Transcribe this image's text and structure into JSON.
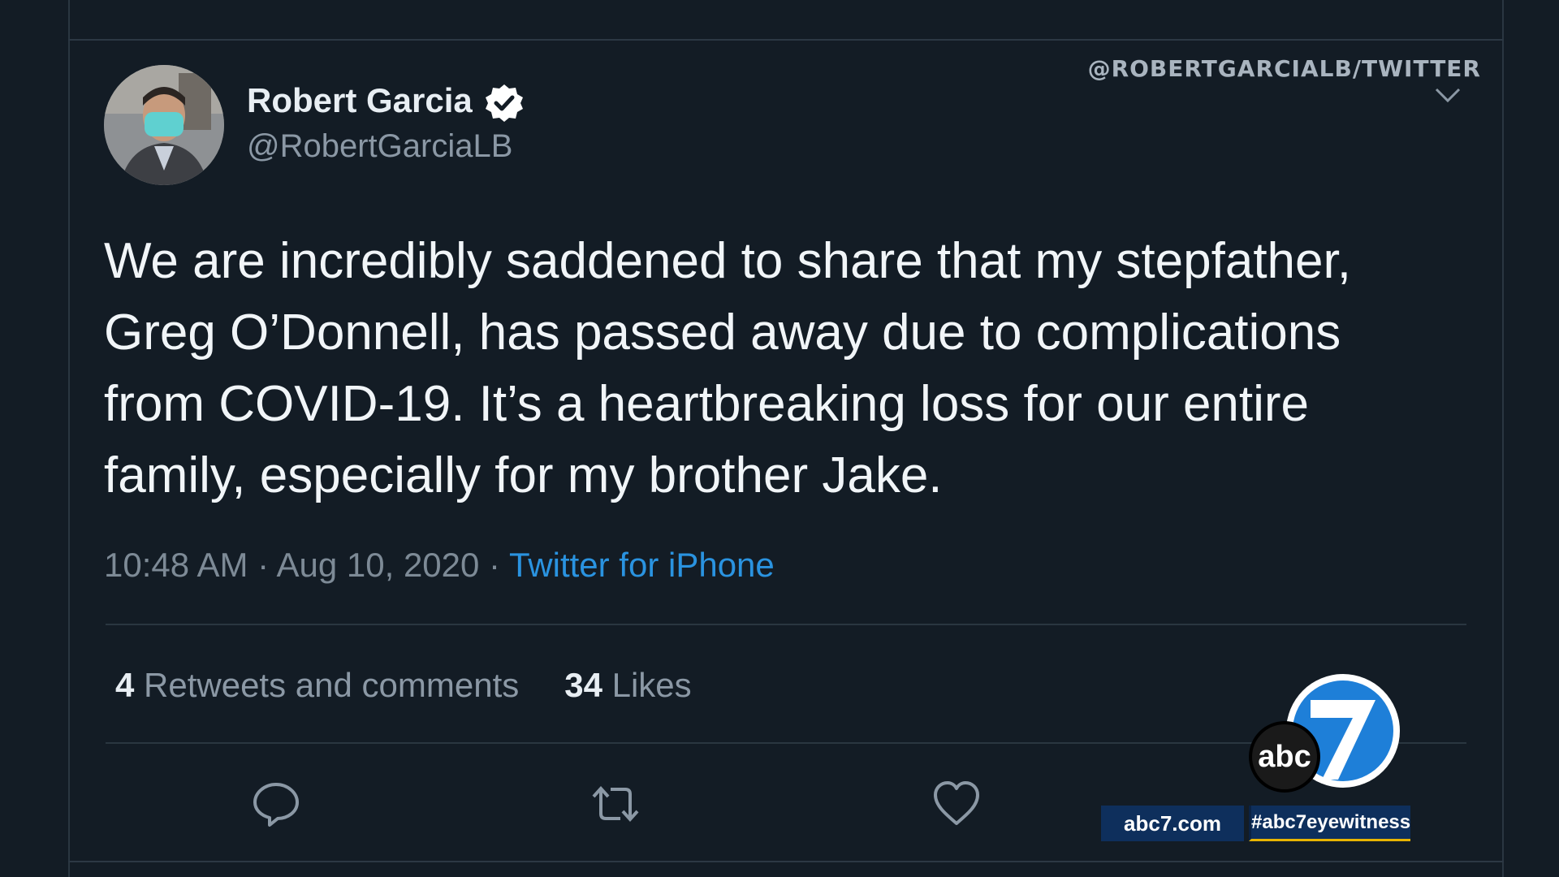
{
  "credit": "@ROBERTGARCIALB/TWITTER",
  "author": {
    "display_name": "Robert Garcia",
    "handle": "@RobertGarciaLB",
    "verified": true
  },
  "tweet": {
    "line1": "We are incredibly saddened to share that my stepfather,",
    "line2": "Greg O’Donnell, has passed away due to complications",
    "line3": "from COVID-19. It’s a heartbreaking loss for our entire",
    "line4": "family, especially for my brother Jake."
  },
  "meta": {
    "time": "10:48 AM",
    "sep1": " · ",
    "date": "Aug 10, 2020",
    "sep2": " · ",
    "source": "Twitter for iPhone"
  },
  "stats": {
    "retweets_count": "4",
    "retweets_label": " Retweets and comments",
    "likes_count": "34",
    "likes_label": " Likes"
  },
  "actions": [
    "reply-icon",
    "retweet-icon",
    "like-icon"
  ],
  "broadcast": {
    "logo_text": "abc",
    "channel": "7",
    "site": "abc7.com",
    "hashtag": "#abc7eyewitness"
  },
  "colors": {
    "background": "#131c25",
    "text": "#f1f5f8",
    "muted": "#8b98a5",
    "link": "#2a93e0",
    "verified": "#ffffff",
    "station_blue": "#0e2f5c"
  }
}
